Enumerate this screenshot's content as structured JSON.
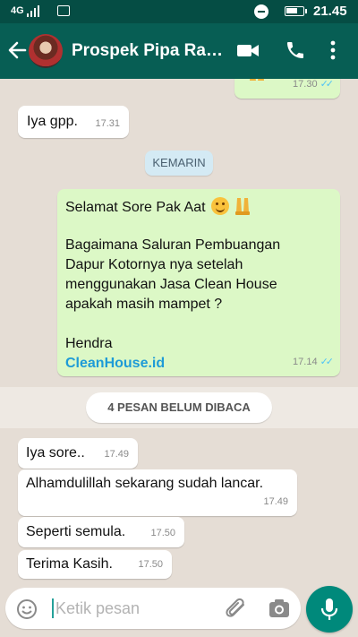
{
  "status_bar": {
    "network": "4G",
    "time": "21.45"
  },
  "app_bar": {
    "title": "Prospek Pipa Raj…"
  },
  "colors": {
    "header": "#075e54",
    "outgoing_bubble": "#dcf8c6",
    "incoming_bubble": "#ffffff",
    "read_ticks": "#4fc3f7",
    "mic_button": "#00897b"
  },
  "messages": {
    "prev_out": {
      "time": "17.30"
    },
    "m1": {
      "text": "Iya gpp.",
      "time": "17.31"
    },
    "date_divider": "KEMARIN",
    "m2": {
      "greeting": "Selamat Sore Pak Aat",
      "body_1": "Bagaimana Saluran Pembuangan",
      "body_2": "Dapur Kotornya nya setelah",
      "body_3": "menggunakan Jasa Clean House",
      "body_4": "apakah masih mampet ?",
      "signature": "Hendra",
      "link": "CleanHouse.id",
      "time": "17.14"
    },
    "unread_banner": "4 PESAN BELUM DIBACA",
    "m3": {
      "text": "Iya sore..",
      "time": "17.49"
    },
    "m4": {
      "text": "Alhamdulillah sekarang sudah lancar.",
      "time": "17.49"
    },
    "m5": {
      "text": "Seperti semula.",
      "time": "17.50"
    },
    "m6": {
      "text": "Terima Kasih.",
      "time": "17.50"
    }
  },
  "composer": {
    "placeholder": "Ketik pesan"
  }
}
